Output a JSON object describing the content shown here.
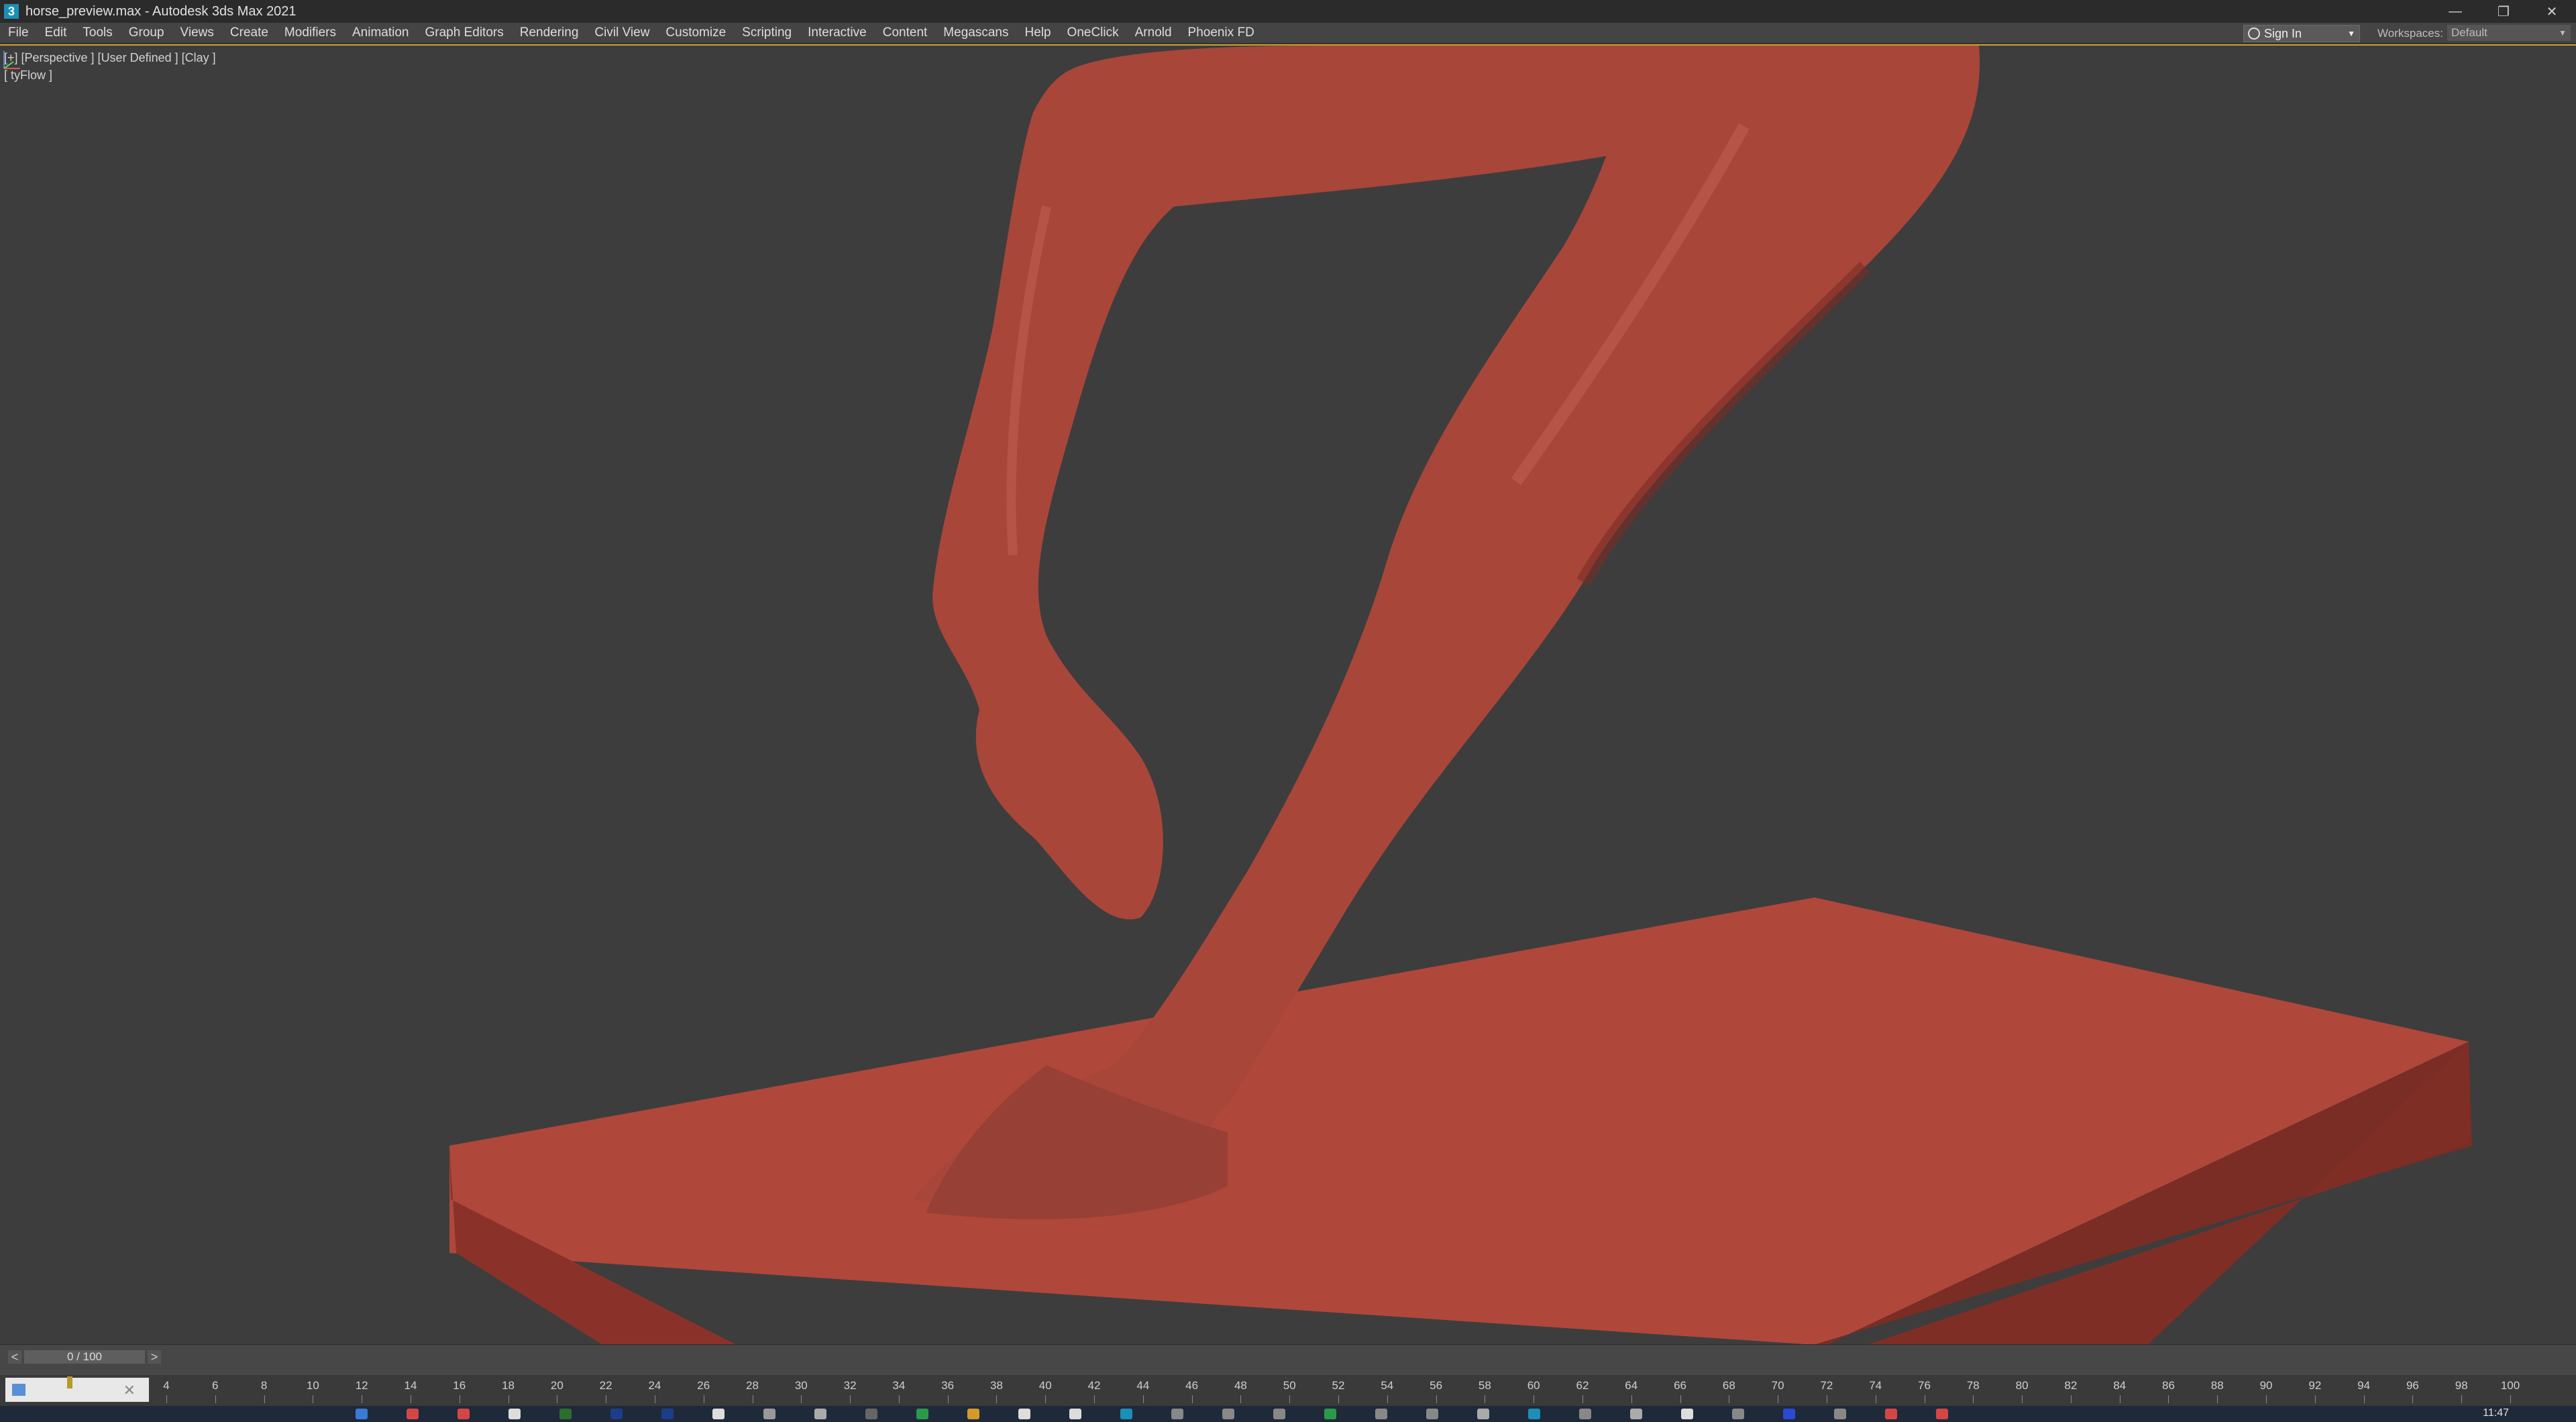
{
  "window": {
    "title": "horse_preview.max - Autodesk 3ds Max 2021",
    "app_icon_glyph": "3",
    "controls": {
      "minimize": "—",
      "restore": "❐",
      "close": "✕"
    }
  },
  "menu": {
    "items": [
      "File",
      "Edit",
      "Tools",
      "Group",
      "Views",
      "Create",
      "Modifiers",
      "Animation",
      "Graph Editors",
      "Rendering",
      "Civil View",
      "Customize",
      "Scripting",
      "Interactive",
      "Content",
      "Megascans",
      "Help",
      "OneClick",
      "Arnold",
      "Phoenix FD"
    ],
    "sign_in": "Sign In",
    "workspaces_label": "Workspaces:",
    "workspaces_value": "Default"
  },
  "viewport": {
    "label": "[+] [Perspective ] [User Defined ] [Clay ]",
    "sublabel": "[ tyFlow ]",
    "model_color": "#a8463a",
    "base_color": "#b0473b",
    "background": "#3d3d3d"
  },
  "timeslider": {
    "position_text": "0 / 100",
    "prev": "<",
    "next": ">"
  },
  "trackbar": {
    "ticks": [
      "4",
      "6",
      "8",
      "10",
      "12",
      "14",
      "16",
      "18",
      "20",
      "22",
      "24",
      "26",
      "28",
      "30",
      "32",
      "34",
      "36",
      "38",
      "40",
      "42",
      "44",
      "46",
      "48",
      "50",
      "52",
      "54",
      "56",
      "58",
      "60",
      "62",
      "64",
      "66",
      "68",
      "70",
      "72",
      "74",
      "76",
      "78",
      "80",
      "82",
      "84",
      "86",
      "88",
      "90",
      "92",
      "94",
      "96",
      "98",
      "100"
    ]
  },
  "taskbar": {
    "clock": "11:47"
  }
}
